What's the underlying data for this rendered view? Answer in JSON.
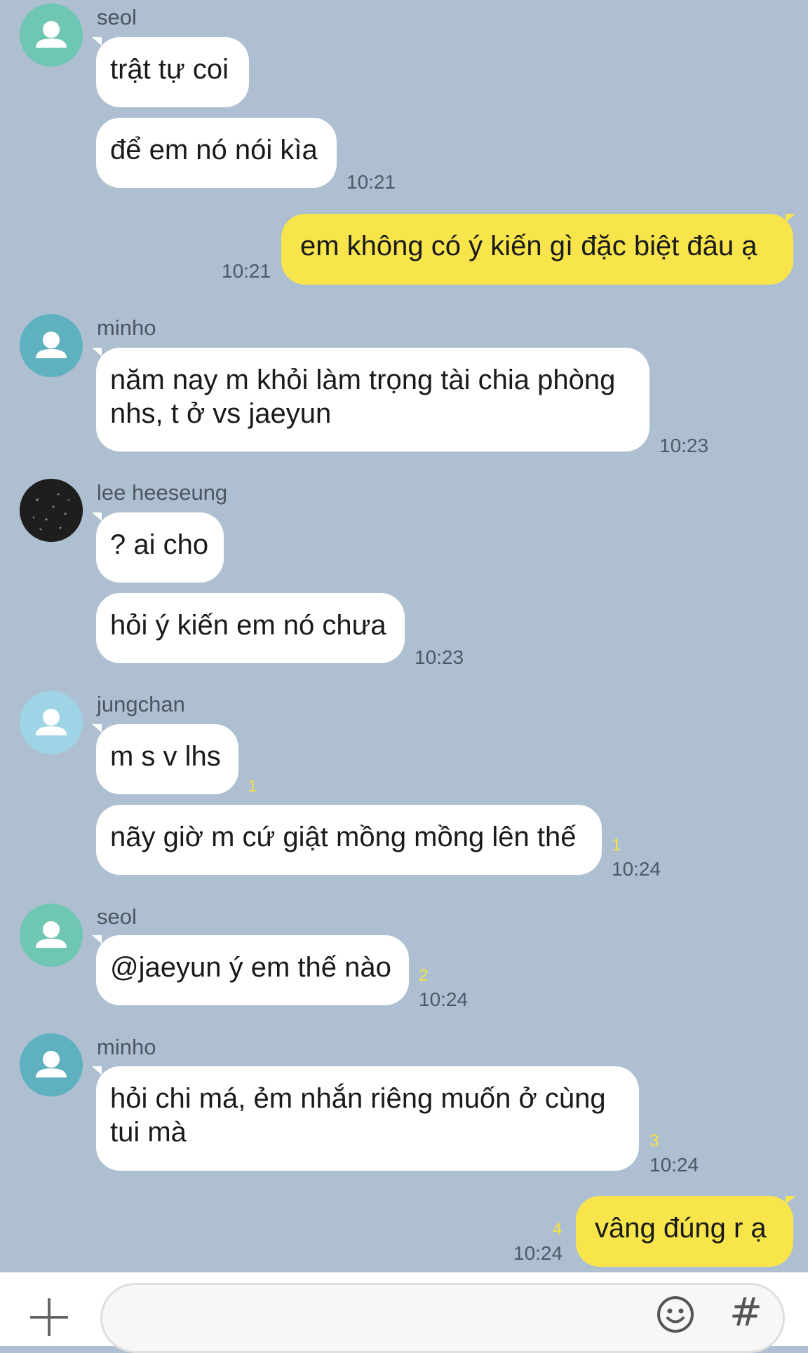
{
  "colors": {
    "background": "#adbfd0",
    "bubble_other": "#ffffff",
    "bubble_mine": "#f8e54b",
    "unread": "#f6e43a"
  },
  "messages": {
    "m1": {
      "sender": "seol",
      "text": "trật tự coi"
    },
    "m2": {
      "text": "để em nó nói kìa",
      "time": "10:21"
    },
    "m3": {
      "text": "em không có ý kiến gì đặc biệt đâu ạ",
      "time": "10:21"
    },
    "m4": {
      "sender": "minho",
      "line1": "năm nay m khỏi làm trọng tài chia phòng",
      "line2": "nhs, t ở vs jaeyun",
      "time": "10:23"
    },
    "m5": {
      "sender": "lee heeseung",
      "text": "? ai cho"
    },
    "m6": {
      "text": "hỏi ý kiến em nó chưa",
      "time": "10:23"
    },
    "m7": {
      "sender": "jungchan",
      "text": "m s v lhs",
      "unread": "1"
    },
    "m8": {
      "text": "nãy giờ m cứ giật mồng mồng lên thế",
      "unread": "1",
      "time": "10:24"
    },
    "m9": {
      "sender": "seol",
      "text": "@jaeyun ý em thế nào",
      "unread": "2",
      "time": "10:24"
    },
    "m10": {
      "sender": "minho",
      "line1": "hỏi chi má, ẻm nhắn riêng muốn ở cùng",
      "line2": "tui mà",
      "unread": "3",
      "time": "10:24"
    },
    "m11": {
      "text": "vâng đúng r ạ",
      "unread": "4",
      "time": "10:24"
    }
  },
  "input": {
    "placeholder": ""
  },
  "icons": {
    "plus": "plus-icon",
    "emoji": "emoji-icon",
    "hash": "hash-icon",
    "avatar": "person-icon"
  }
}
